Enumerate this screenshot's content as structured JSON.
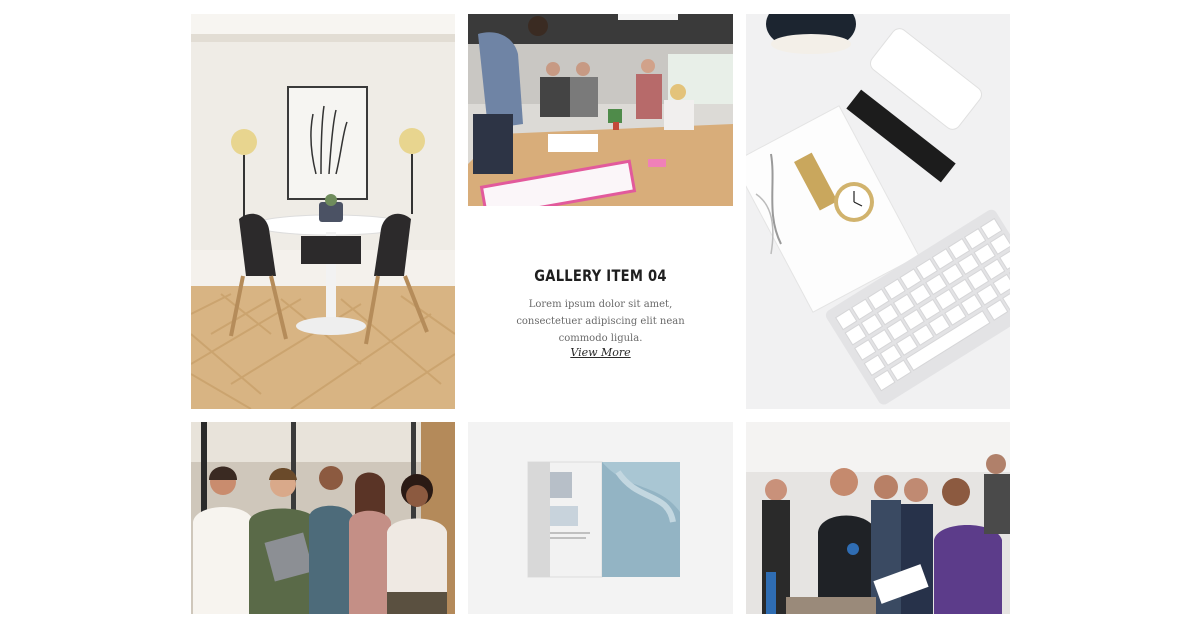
{
  "gallery": {
    "items": [
      {
        "image": "dining-room-photo"
      },
      {
        "image": "office-meeting-photo"
      },
      {
        "image": "desk-flatlay-photo"
      },
      {
        "image": "team-group-photo"
      },
      {
        "image": "magazine-mockup-photo"
      },
      {
        "image": "expo-crowd-photo"
      }
    ],
    "featured": {
      "title": "GALLERY ITEM 04",
      "description": "Lorem ipsum dolor sit amet, consectetuer adipiscing elit nean commodo ligula.",
      "link_label": "View More"
    }
  }
}
